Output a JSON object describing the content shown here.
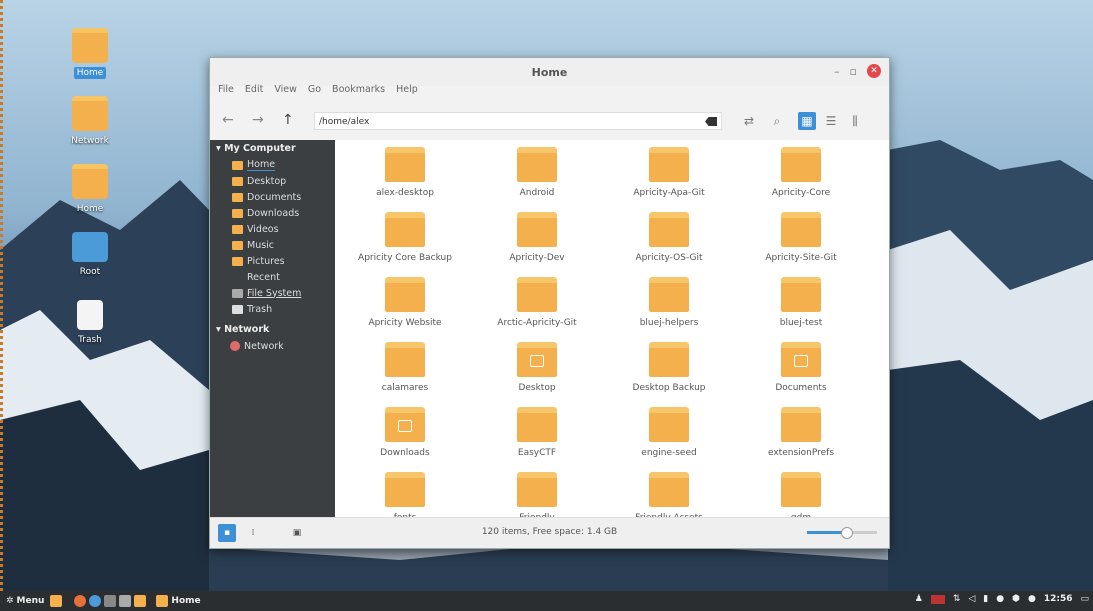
{
  "desktop": {
    "icons": [
      {
        "label": "Home",
        "selected": true
      },
      {
        "label": "Network"
      },
      {
        "label": "Home"
      },
      {
        "label": "Root"
      },
      {
        "label": "Trash"
      }
    ]
  },
  "window": {
    "title": "Home",
    "menu": [
      "File",
      "Edit",
      "View",
      "Go",
      "Bookmarks",
      "Help"
    ],
    "path": "/home/alex",
    "sidebar": {
      "my_computer": "My Computer",
      "items": [
        "Home",
        "Desktop",
        "Documents",
        "Downloads",
        "Videos",
        "Music",
        "Pictures",
        "Recent",
        "File System",
        "Trash"
      ],
      "network_head": "Network",
      "network_items": [
        "Network"
      ]
    },
    "files": [
      "alex-desktop",
      "Android",
      "Apricity-Apa-Git",
      "Apricity-Core",
      "Apricity Core Backup",
      "Apricity-Dev",
      "Apricity-OS-Git",
      "Apricity-Site-Git",
      "Apricity Website",
      "Arctic-Apricity-Git",
      "bluej-helpers",
      "bluej-test",
      "calamares",
      "Desktop",
      "Desktop Backup",
      "Documents",
      "Downloads",
      "EasyCTF",
      "engine-seed",
      "extensionPrefs",
      "fonts",
      "Friendly",
      "Friendly Assets",
      "gdm"
    ],
    "status": "120 items, Free space: 1.4 GB",
    "zoom_level": 0.55
  },
  "taskbar": {
    "menu_label": "Menu",
    "active_window": "Home",
    "clock": "12:56"
  },
  "colors": {
    "accent": "#3d8fd6",
    "folder": "#f3b04d",
    "sidebar_bg": "#3c3f41",
    "close": "#e2474b"
  }
}
